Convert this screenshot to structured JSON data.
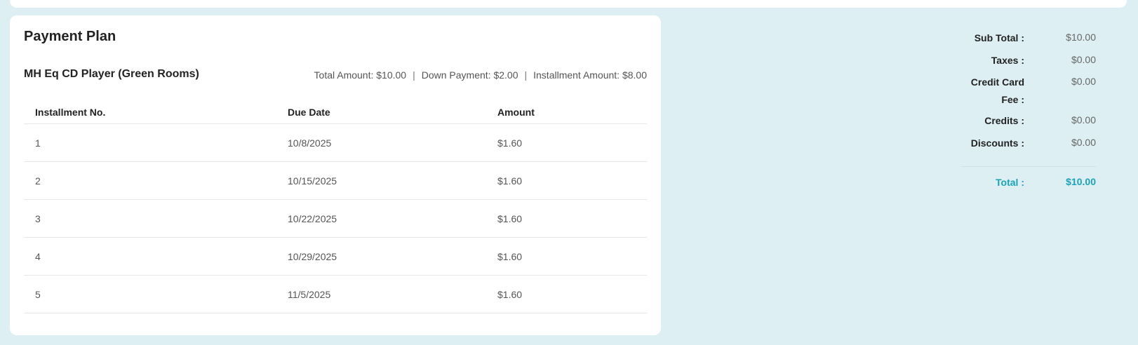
{
  "payment_plan": {
    "title": "Payment Plan",
    "item_name": "MH Eq CD Player (Green Rooms)",
    "total_amount_text": "Total Amount: $10.00",
    "down_payment_text": "Down Payment: $2.00",
    "installment_amount_text": "Installment Amount: $8.00",
    "separator": "|",
    "columns": [
      "Installment No.",
      "Due Date",
      "Amount"
    ],
    "rows": [
      {
        "no": "1",
        "due": "10/8/2025",
        "amount": "$1.60"
      },
      {
        "no": "2",
        "due": "10/15/2025",
        "amount": "$1.60"
      },
      {
        "no": "3",
        "due": "10/22/2025",
        "amount": "$1.60"
      },
      {
        "no": "4",
        "due": "10/29/2025",
        "amount": "$1.60"
      },
      {
        "no": "5",
        "due": "11/5/2025",
        "amount": "$1.60"
      }
    ]
  },
  "totals": {
    "sub_total": {
      "label": "Sub Total :",
      "value": "$10.00"
    },
    "taxes": {
      "label": "Taxes :",
      "value": "$0.00"
    },
    "credit_card_fee": {
      "label_line1": "Credit Card",
      "label_line2": "Fee :",
      "value": "$0.00"
    },
    "credits": {
      "label": "Credits :",
      "value": "$0.00"
    },
    "discounts": {
      "label": "Discounts :",
      "value": "$0.00"
    },
    "total": {
      "label": "Total :",
      "value": "$10.00"
    }
  },
  "colors": {
    "background": "#ddeff2",
    "accent": "#1aa3b8"
  }
}
